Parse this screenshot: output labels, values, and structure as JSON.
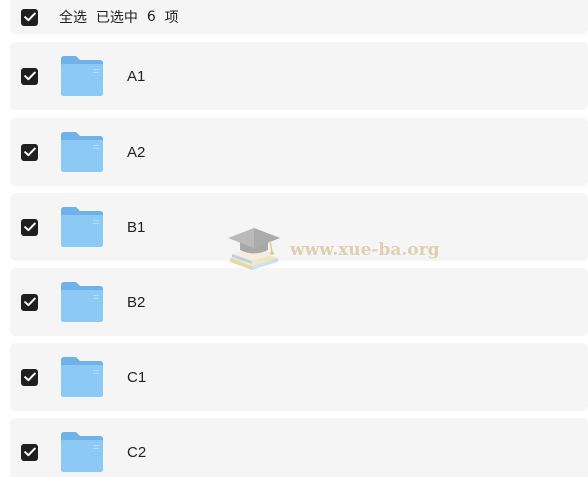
{
  "header": {
    "select_all_label": "全选",
    "selected_prefix": "已选中",
    "selected_count": "6",
    "selected_suffix": "项",
    "select_all_checked": true
  },
  "items": [
    {
      "name": "A1",
      "icon": "folder-icon",
      "checked": true
    },
    {
      "name": "A2",
      "icon": "folder-icon",
      "checked": true
    },
    {
      "name": "B1",
      "icon": "folder-icon",
      "checked": true
    },
    {
      "name": "B2",
      "icon": "folder-icon",
      "checked": true
    },
    {
      "name": "C1",
      "icon": "folder-icon",
      "checked": true
    },
    {
      "name": "C2",
      "icon": "folder-icon",
      "checked": true
    }
  ],
  "watermark": {
    "text": "www.xue-ba.org",
    "icon": "graduation-cap-books-icon"
  },
  "colors": {
    "checkbox": "#1f1f1f",
    "row_background": "#f5f5f5",
    "folder_back": "#6fb2ea",
    "folder_front": "#8ccaf5"
  }
}
